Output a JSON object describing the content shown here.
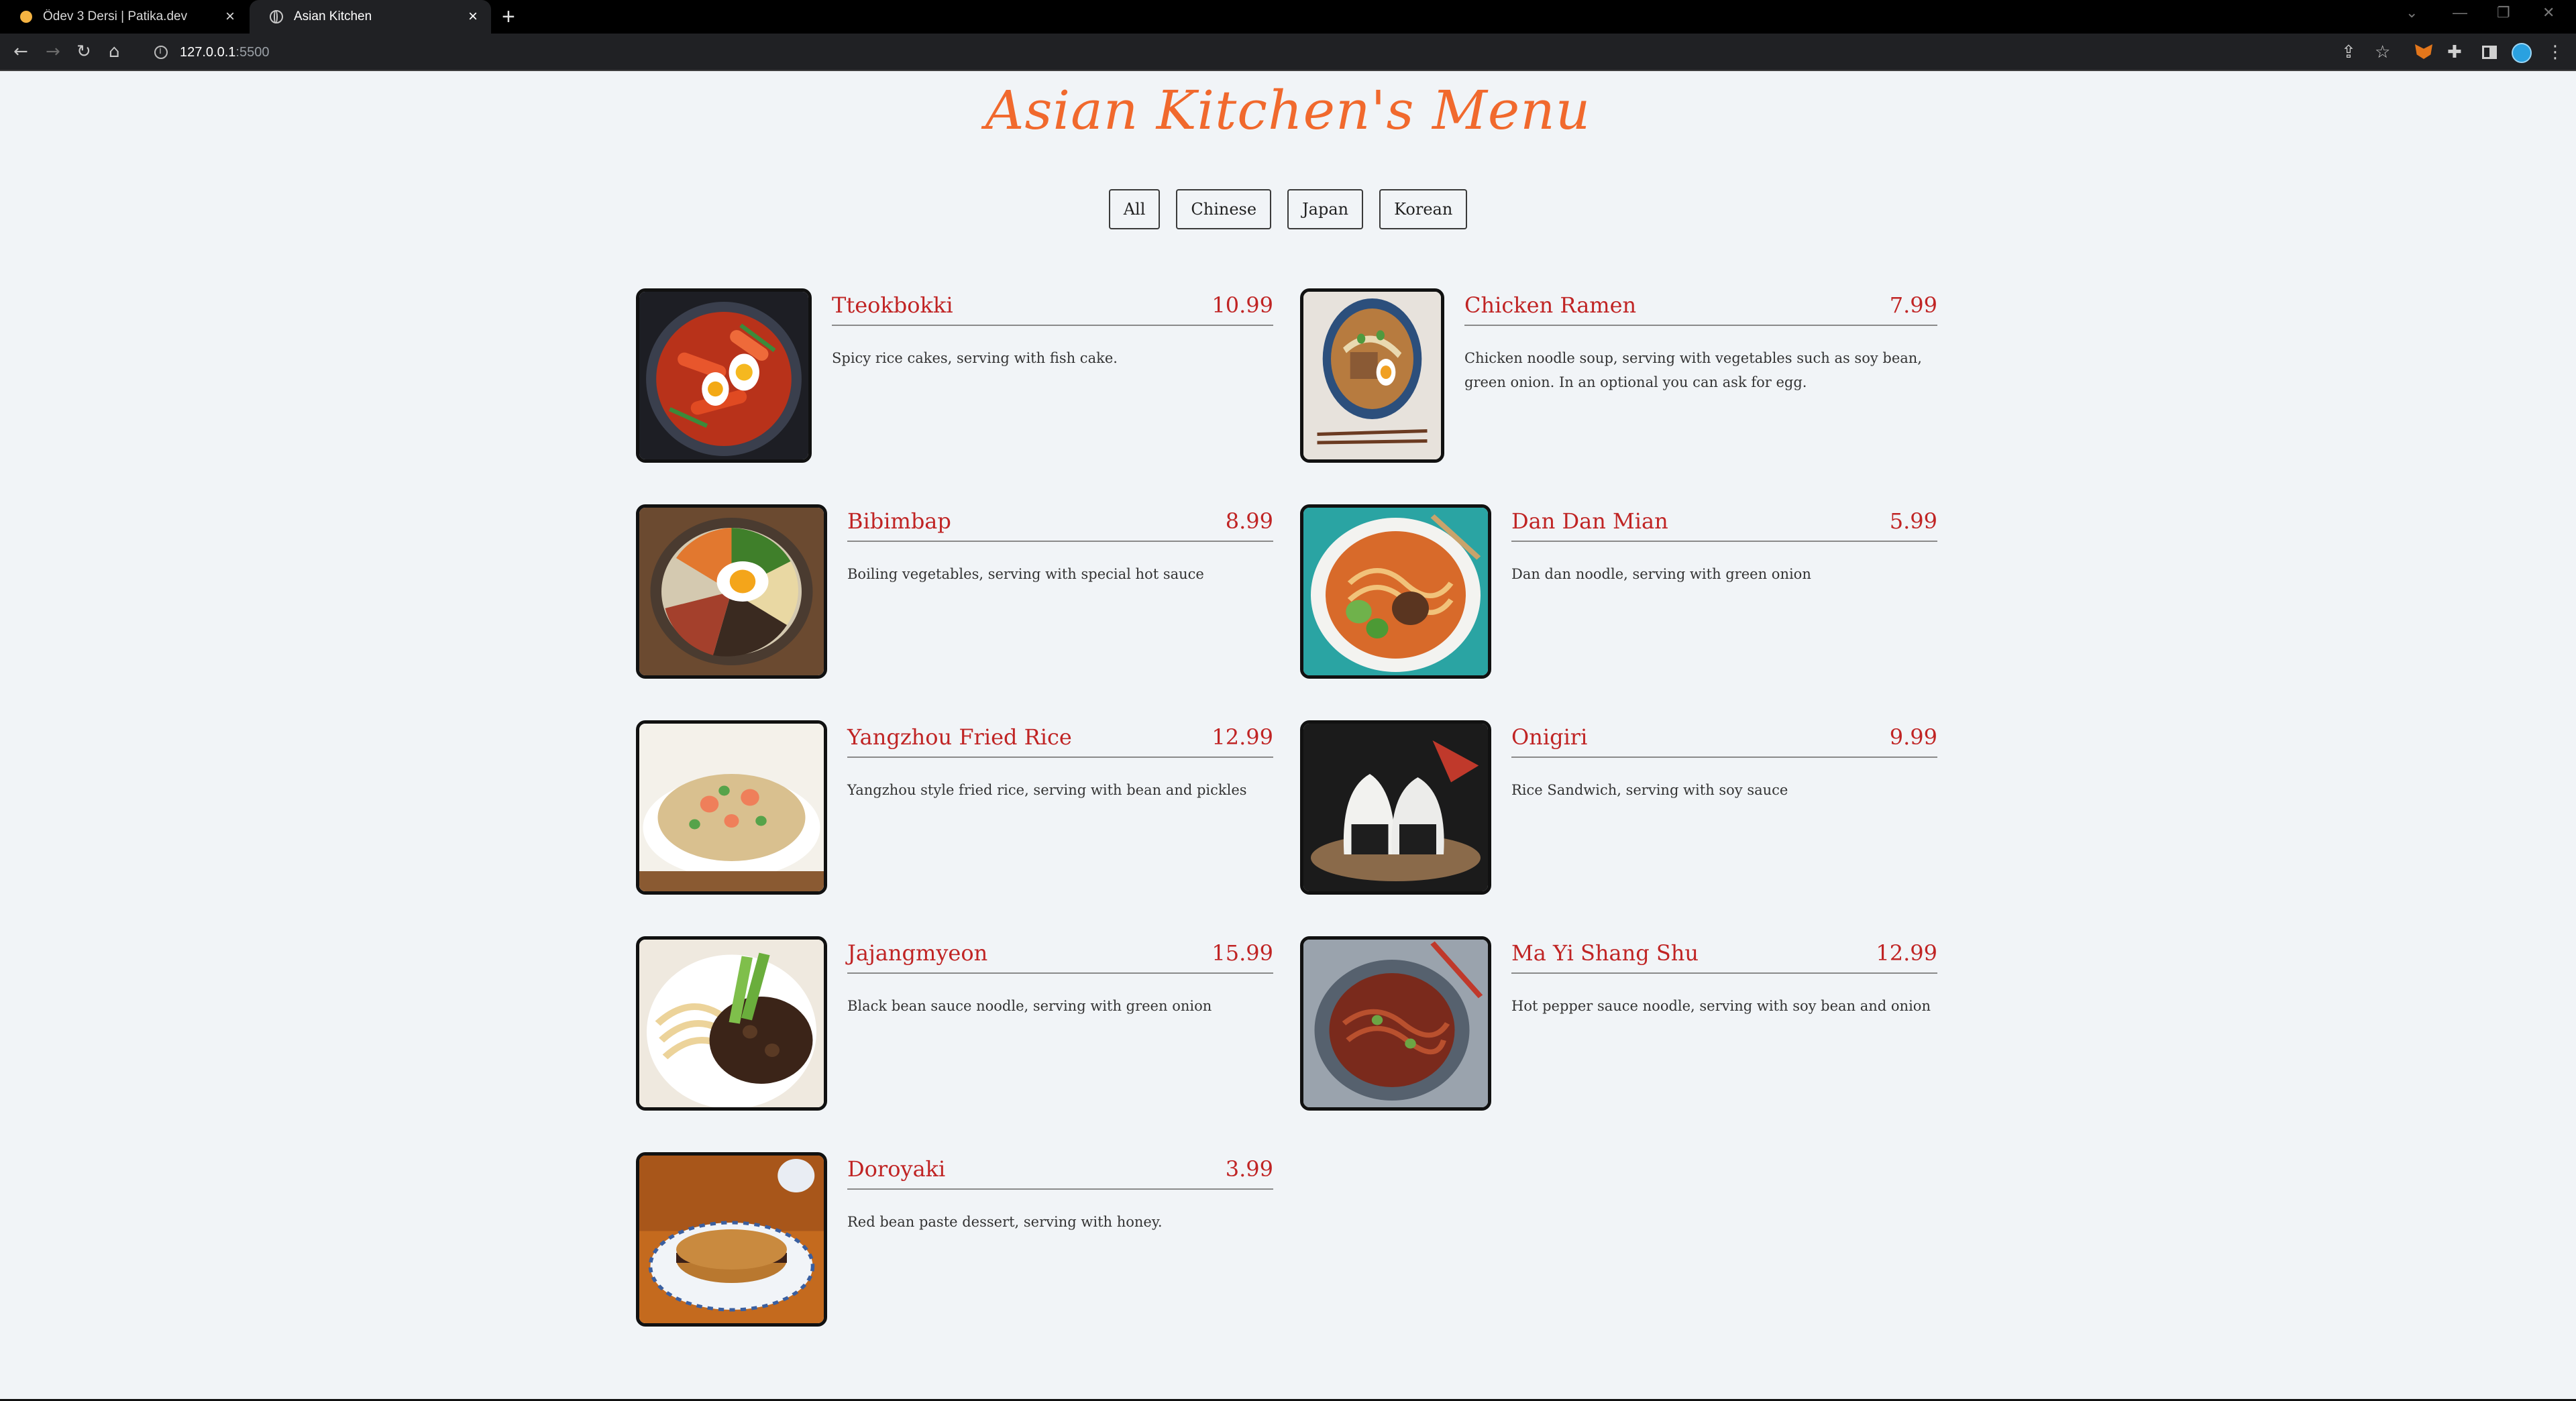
{
  "browser": {
    "tabs": [
      {
        "title": "Ödev 3 Dersi | Patika.dev",
        "close": "×"
      },
      {
        "title": "Asian Kitchen",
        "close": "×"
      }
    ],
    "new_tab": "+",
    "url_host": "127.0.0.1",
    "url_port": ":5500"
  },
  "page": {
    "title": "Asian Kitchen's Menu",
    "filters": [
      "All",
      "Chinese",
      "Japan",
      "Korean"
    ]
  },
  "menu": [
    {
      "name": "Tteokbokki",
      "price": "10.99",
      "desc": "Spicy rice cakes, serving with fish cake.",
      "image": "tteokbokki-bowl"
    },
    {
      "name": "Chicken Ramen",
      "price": "7.99",
      "desc": "Chicken noodle soup, serving with vegetables such as soy bean, green onion. In an optional you can ask for egg.",
      "image": "ramen-bowl"
    },
    {
      "name": "Bibimbap",
      "price": "8.99",
      "desc": "Boiling vegetables, serving with special hot sauce",
      "image": "bibimbap-bowl"
    },
    {
      "name": "Dan Dan Mian",
      "price": "5.99",
      "desc": "Dan dan noodle, serving with green onion",
      "image": "dandan-noodle-bowl"
    },
    {
      "name": "Yangzhou Fried Rice",
      "price": "12.99",
      "desc": "Yangzhou style fried rice, serving with bean and pickles",
      "image": "fried-rice-plate"
    },
    {
      "name": "Onigiri",
      "price": "9.99",
      "desc": "Rice Sandwich, serving with soy sauce",
      "image": "onigiri-plate"
    },
    {
      "name": "Jajangmyeon",
      "price": "15.99",
      "desc": "Black bean sauce noodle, serving with green onion",
      "image": "jajangmyeon-bowl"
    },
    {
      "name": "Ma Yi Shang Shu",
      "price": "12.99",
      "desc": "Hot pepper sauce noodle, serving with soy bean and onion",
      "image": "mayi-noodle-plate"
    },
    {
      "name": "Doroyaki",
      "price": "3.99",
      "desc": "Red bean paste dessert, serving with honey.",
      "image": "dorayaki-plate"
    }
  ]
}
